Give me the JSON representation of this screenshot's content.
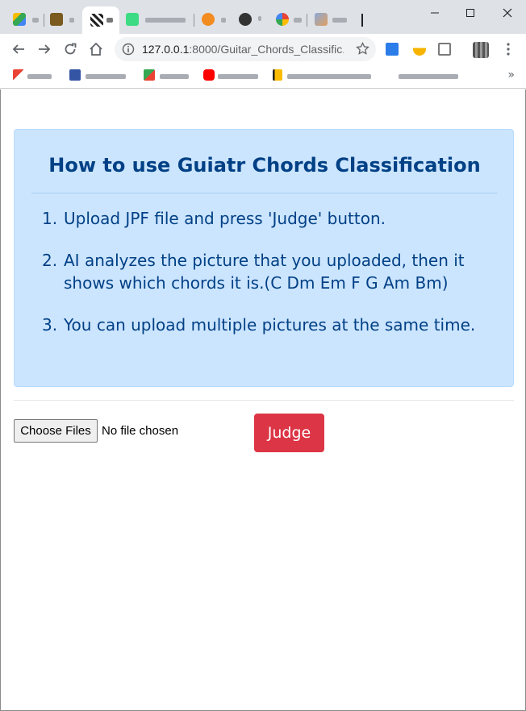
{
  "browser": {
    "address": {
      "host": "127.0.0.1",
      "path": ":8000/Guitar_Chords_Classific..."
    },
    "colors": {
      "tabstrip": "#dee1e6",
      "omnibox": "#f1f3f4"
    }
  },
  "page": {
    "info_title": "How to use Guiatr Chords Classification",
    "steps": [
      {
        "num": "1.",
        "text": "Upload JPF file and press 'Judge' button."
      },
      {
        "num": "2.",
        "text": "AI analyzes the picture that you uploaded, then it shows which chords it is.(C Dm Em F G Am Bm)"
      },
      {
        "num": "3.",
        "text": "You can upload multiple pictures at the same time."
      }
    ],
    "file_input": {
      "button_label": "Choose Files",
      "status": "No file chosen"
    },
    "judge_label": "Judge",
    "colors": {
      "info_bg": "#cce5ff",
      "info_text": "#004085",
      "judge_bg": "#dc3545"
    }
  }
}
